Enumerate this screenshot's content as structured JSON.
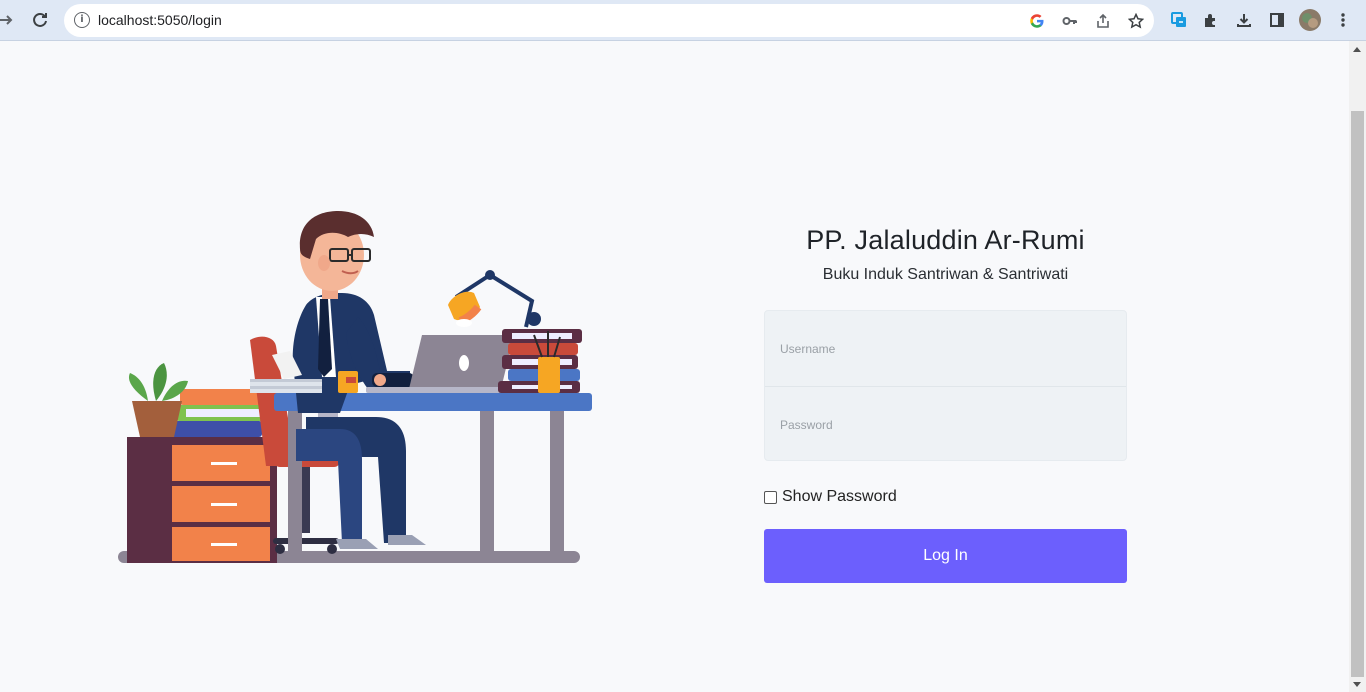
{
  "browser": {
    "url": "localhost:5050/login"
  },
  "login": {
    "title": "PP. Jalaluddin Ar-Rumi",
    "subtitle": "Buku Induk Santriwan & Santriwati",
    "username_placeholder": "Username",
    "password_placeholder": "Password",
    "show_password_label": "Show Password",
    "submit_label": "Log In"
  },
  "colors": {
    "accent": "#6c5ffd",
    "field_bg": "#eef2f5",
    "page_bg": "#f8f9fb"
  }
}
